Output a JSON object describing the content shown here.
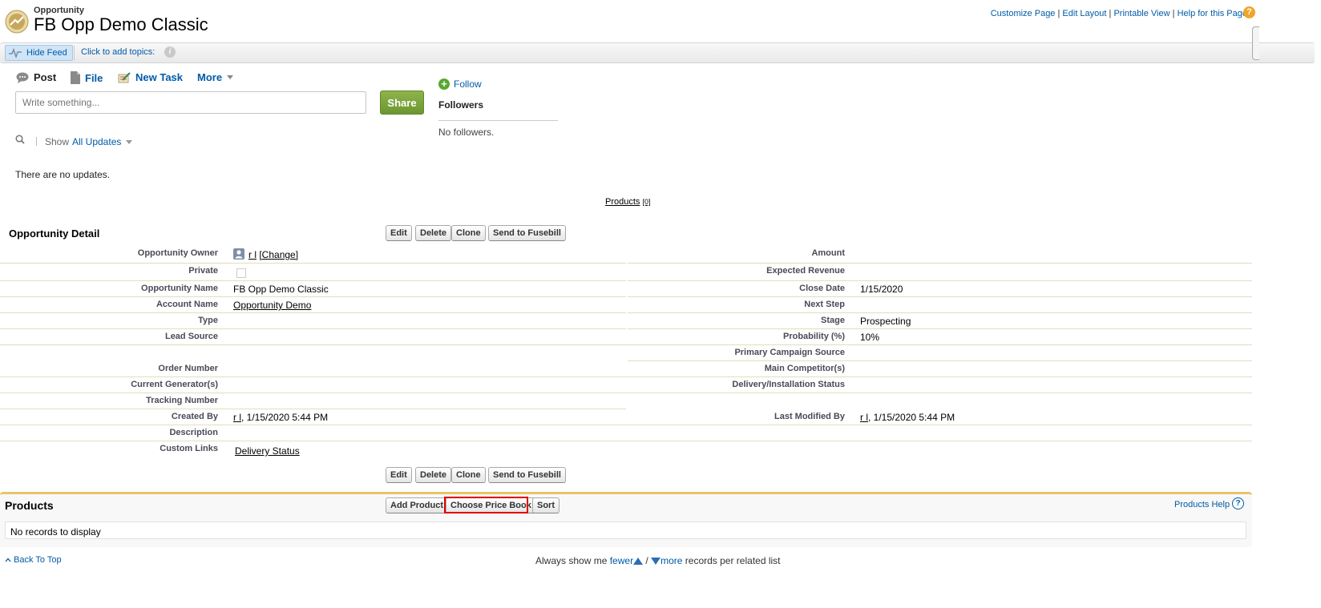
{
  "header": {
    "object_type": "Opportunity",
    "record_title": "FB Opp Demo Classic",
    "links": [
      "Customize Page",
      "Edit Layout",
      "Printable View",
      "Help for this Page"
    ],
    "separator": "|",
    "help_icon": "?"
  },
  "feedbar": {
    "hide_feed": "Hide Feed",
    "topics": "Click to add topics:",
    "info_icon": "i"
  },
  "publisher": {
    "tabs": [
      "Post",
      "File",
      "New Task",
      "More"
    ],
    "placeholder": "Write something...",
    "share": "Share"
  },
  "feed": {
    "show_label": "Show",
    "show_value": "All Updates",
    "empty": "There are no updates."
  },
  "followers": {
    "plus": "+",
    "follow": "Follow",
    "title": "Followers",
    "empty": "No followers."
  },
  "products_link": {
    "label": "Products",
    "count": "[0]"
  },
  "detail": {
    "title": "Opportunity Detail",
    "buttons": [
      "Edit",
      "Delete",
      "Clone",
      "Send to Fusebill"
    ],
    "left": [
      {
        "label": "Opportunity Owner",
        "value": "r l",
        "extra": "[Change]"
      },
      {
        "label": "Private",
        "value": ""
      },
      {
        "label": "Opportunity Name",
        "value": "FB Opp Demo Classic"
      },
      {
        "label": "Account Name",
        "value": "Opportunity Demo"
      },
      {
        "label": "Type",
        "value": ""
      },
      {
        "label": "Lead Source",
        "value": ""
      },
      {
        "label": "Order Number",
        "value": ""
      },
      {
        "label": "Current Generator(s)",
        "value": ""
      },
      {
        "label": "Tracking Number",
        "value": ""
      },
      {
        "label": "Created By",
        "value": "r l",
        "extra": ", 1/15/2020 5:44 PM"
      }
    ],
    "right": [
      {
        "label": "Amount",
        "value": ""
      },
      {
        "label": "Expected Revenue",
        "value": ""
      },
      {
        "label": "Close Date",
        "value": "1/15/2020"
      },
      {
        "label": "Next Step",
        "value": ""
      },
      {
        "label": "Stage",
        "value": "Prospecting"
      },
      {
        "label": "Probability (%)",
        "value": "10%"
      },
      {
        "label": "Primary Campaign Source",
        "value": ""
      },
      {
        "label": "Main Competitor(s)",
        "value": ""
      },
      {
        "label": "Delivery/Installation Status",
        "value": ""
      },
      {
        "label": "Last Modified By",
        "value": "r l",
        "extra": ", 1/15/2020 5:44 PM"
      }
    ],
    "description_label": "Description",
    "custom_links_label": "Custom Links",
    "custom_link": "Delivery Status"
  },
  "products": {
    "title": "Products",
    "buttons": [
      "Add Product",
      "Choose Price Book",
      "Sort"
    ],
    "help": "Products Help",
    "help_icon": "?",
    "empty": "No records to display"
  },
  "footer": {
    "back_to_top": "Back To Top",
    "always_prefix": "Always show me",
    "fewer": "fewer",
    "slash": "/",
    "more": "more",
    "suffix": "records per related list"
  },
  "colors": {
    "link": "#015ba7",
    "share_button": "#7aa33b",
    "section_accent": "#e8c464",
    "highlight": "#e00000"
  }
}
